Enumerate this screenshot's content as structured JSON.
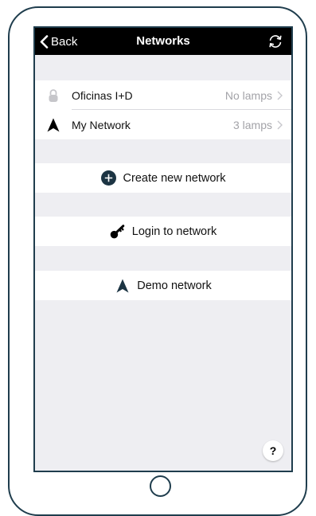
{
  "navbar": {
    "back_label": "Back",
    "title": "Networks",
    "sync_icon": "sync-icon"
  },
  "networks": [
    {
      "name": "Oficinas I+D",
      "detail": "No lamps",
      "icon": "lock-icon"
    },
    {
      "name": "My Network",
      "detail": "3 lamps",
      "icon": "network-arrow-icon"
    }
  ],
  "actions": {
    "create": {
      "label": "Create new network",
      "icon": "plus-circle-icon"
    },
    "login": {
      "label": "Login to network",
      "icon": "key-icon"
    },
    "demo": {
      "label": "Demo network",
      "icon": "network-arrow-icon"
    }
  },
  "help": {
    "label": "?"
  },
  "colors": {
    "device_frame": "#1f3d4d",
    "navbar_bg": "#000000",
    "screen_bg": "#eeeef2",
    "detail_text": "#a3a3a8"
  }
}
